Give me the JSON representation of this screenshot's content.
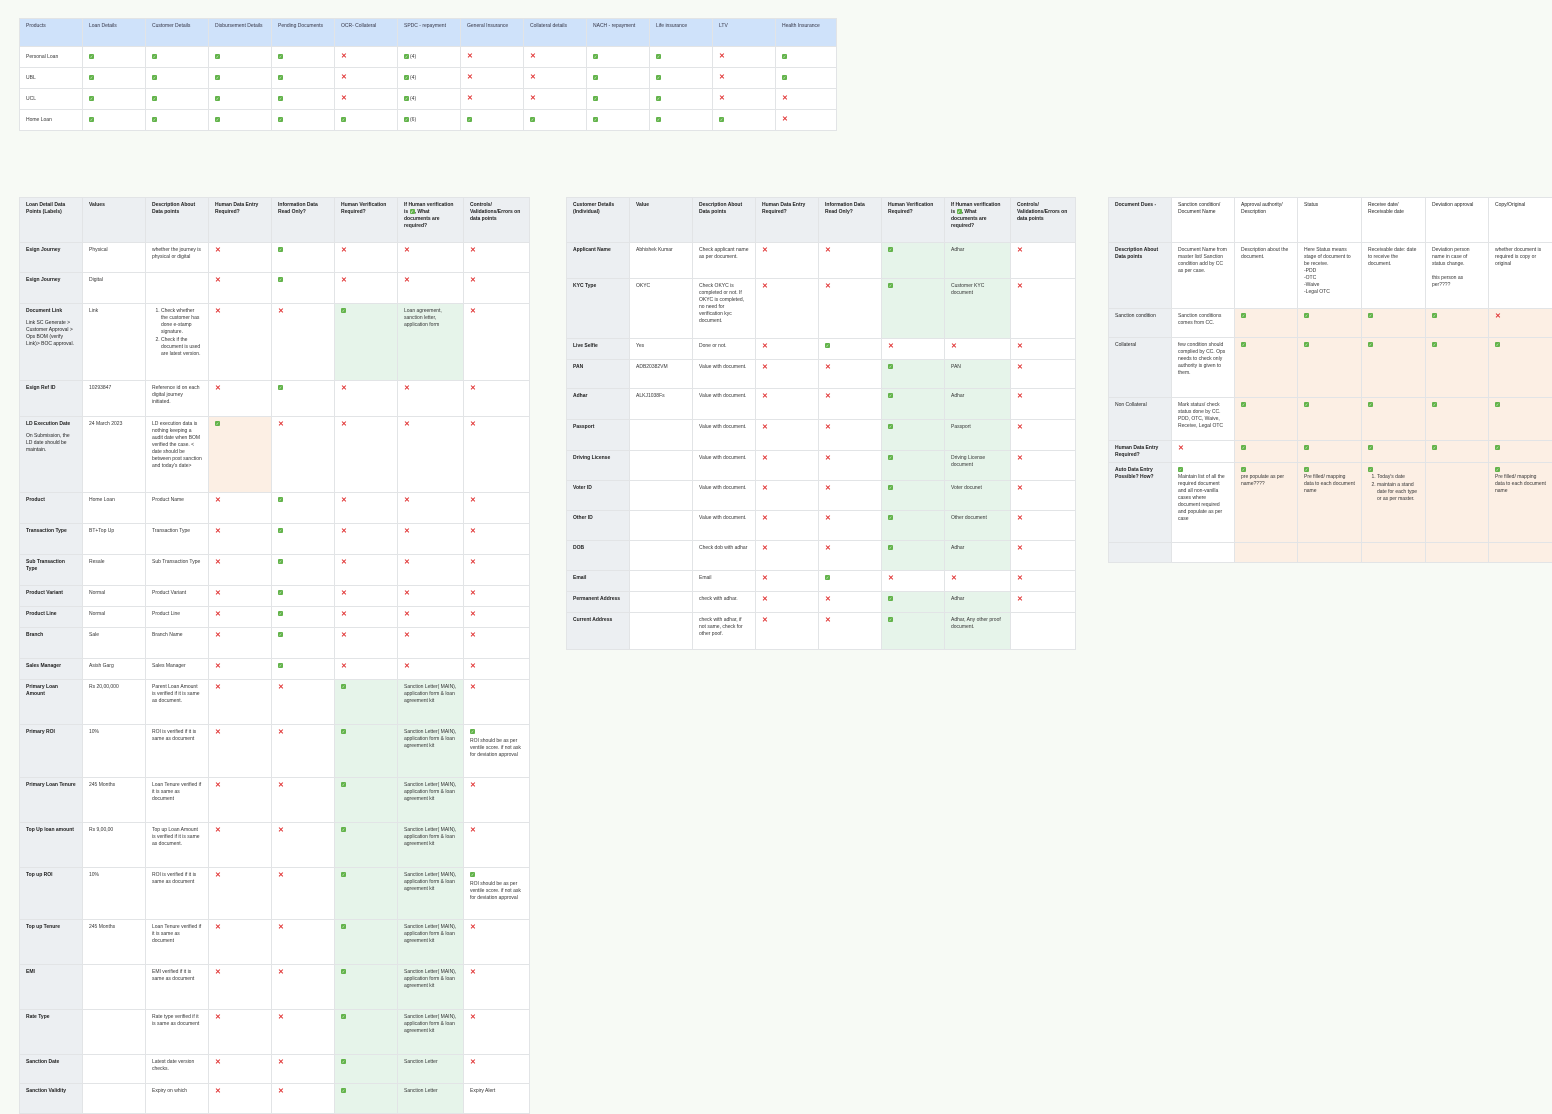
{
  "colors": {
    "header_blue": "#cfe2fa",
    "label_grey": "#eceff2",
    "tick_green": "#62b34a",
    "cross_red": "#e03131",
    "highlight_green": "#e6f4ea",
    "highlight_orange": "#fcefe4"
  },
  "icons": {
    "yes": "check-icon",
    "no": "cross-icon"
  },
  "products_table": {
    "headers": [
      "Products",
      "Loan Details",
      "Customer Details",
      "Disbursement Details",
      "Pending Documents",
      "OCR- Collateral",
      "SPDC - repayment",
      "General Insurance",
      "Collateral details",
      "NACH - repayment",
      "Life insurance",
      "LTV",
      "Health Insurance"
    ],
    "rows": [
      {
        "name": "Personal Loan",
        "cells": [
          "y",
          "y",
          "y",
          "y",
          "n",
          "y",
          "n",
          "n",
          "y",
          "y",
          "n",
          "y"
        ],
        "spdc_count": "(4)"
      },
      {
        "name": "UBL",
        "cells": [
          "y",
          "y",
          "y",
          "y",
          "n",
          "y",
          "n",
          "n",
          "y",
          "y",
          "n",
          "y"
        ],
        "spdc_count": "(4)"
      },
      {
        "name": "UCL",
        "cells": [
          "y",
          "y",
          "y",
          "y",
          "n",
          "y",
          "n",
          "n",
          "y",
          "y",
          "n",
          "n"
        ],
        "spdc_count": "(4)"
      },
      {
        "name": "Home Loan",
        "cells": [
          "y",
          "y",
          "y",
          "y",
          "y",
          "y",
          "y",
          "y",
          "y",
          "y",
          "y",
          "n"
        ],
        "spdc_count": "(6)"
      }
    ]
  },
  "loan_table": {
    "headers": [
      "Loan Detail Data Points (Labels)",
      "Values",
      "Description About Data points",
      "Human Data Entry Required?",
      "Information Data Read Only?",
      "Human Verification Required?",
      "If Human verification is",
      "What documents are required?",
      "Controls/ Validations/Errors on data points"
    ],
    "rows": [
      {
        "label": "Esign Journey",
        "value": "Physical",
        "desc": "whether the journey is physical or digital",
        "marks": [
          "n",
          "y",
          "n",
          "n"
        ],
        "docs": "",
        "ctrl": "n"
      },
      {
        "label": "Esign Journey",
        "value": "Digital",
        "desc": "",
        "marks": [
          "n",
          "y",
          "n",
          "n"
        ],
        "docs": "",
        "ctrl": "n"
      },
      {
        "label": "Document Link",
        "label_note": "Link SC Generate > Customer Approval > Ops BOM (verify Link)> BOC approval.",
        "value": "Link",
        "desc_list": [
          "Check whether the customer has done e-stamp signature.",
          "Check if the document is used are latest version."
        ],
        "marks": [
          "n",
          "n",
          "y",
          ""
        ],
        "docs": "Loan agreement, sanction letter, application form",
        "ctrl": "n"
      },
      {
        "label": "Esign Ref ID",
        "value": "10293847",
        "desc": "Reference id on each digital journey initiated.",
        "marks": [
          "n",
          "y",
          "n",
          "n"
        ],
        "docs": "",
        "ctrl": "n"
      },
      {
        "label": "LD Execution Date",
        "label_note": "On Submission, the LD date should be maintain.",
        "value": "24 March 2023",
        "desc": "LD execution data is nothing keeping a audit date when BOM verified the case. < date should be between post sanction and today's date>",
        "marks": [
          "y",
          "n",
          "n",
          "n"
        ],
        "docs": "",
        "ctrl": "n"
      },
      {
        "label": "Product",
        "value": "Home Loan",
        "desc": "Product Name",
        "marks": [
          "n",
          "y",
          "n",
          "n"
        ],
        "docs": "",
        "ctrl": "n"
      },
      {
        "label": "Transaction Type",
        "value": "BT+Top Up",
        "desc": "Transaction Type",
        "marks": [
          "n",
          "y",
          "n",
          "n"
        ],
        "docs": "",
        "ctrl": "n"
      },
      {
        "label": "Sub Transaction Type",
        "value": "Resale",
        "desc": "Sub Transaction Type",
        "marks": [
          "n",
          "y",
          "n",
          "n"
        ],
        "docs": "",
        "ctrl": "n"
      },
      {
        "label": "Product Variant",
        "value": "Normal",
        "desc": "Product Variant",
        "marks": [
          "n",
          "y",
          "n",
          "n"
        ],
        "docs": "",
        "ctrl": "n"
      },
      {
        "label": "Product Line",
        "value": "Normal",
        "desc": "Product Line",
        "marks": [
          "n",
          "y",
          "n",
          "n"
        ],
        "docs": "",
        "ctrl": "n"
      },
      {
        "label": "Branch",
        "value": "Sale",
        "desc": "Branch Name",
        "marks": [
          "n",
          "y",
          "n",
          "n"
        ],
        "docs": "",
        "ctrl": "n"
      },
      {
        "label": "Sales Manager",
        "value": "Asish Garg",
        "desc": "Sales Manager",
        "marks": [
          "n",
          "y",
          "n",
          "n"
        ],
        "docs": "",
        "ctrl": "n"
      },
      {
        "label": "Primary Loan Amount",
        "value": "Rs 20,00,000",
        "desc": "Parent Loan Amount is verified if it is same as document.",
        "marks": [
          "n",
          "n",
          "y",
          ""
        ],
        "docs": "Sanction Letter( MAIN), application form & loan agreement kit",
        "ctrl": "n"
      },
      {
        "label": "Primary ROI",
        "value": "10%",
        "desc": "ROI is verified if it is same as document",
        "marks": [
          "n",
          "n",
          "y",
          ""
        ],
        "docs": "Sanction Letter( MAIN), application form & loan agreement kit",
        "ctrl": "y",
        "ctrl_note": "ROI should be as per ventile score. if not ask for deviation approval"
      },
      {
        "label": "Primary Loan Tenure",
        "value": "245 Months",
        "desc": "Loan Tenure verified if it is same as document",
        "marks": [
          "n",
          "n",
          "y",
          ""
        ],
        "docs": "Sanction Letter( MAIN), application form & loan agreement kit",
        "ctrl": "n"
      },
      {
        "label": "Top Up loan amount",
        "value": "Rs 9,00,00",
        "desc": "Top up Loan Amount is verified if it is same as document.",
        "marks": [
          "n",
          "n",
          "y",
          ""
        ],
        "docs": "Sanction Letter( MAIN), application form & loan agreement kit",
        "ctrl": "n"
      },
      {
        "label": "Top up ROI",
        "value": "10%",
        "desc": "ROI is verified if it is same as document",
        "marks": [
          "n",
          "n",
          "y",
          ""
        ],
        "docs": "Sanction Letter( MAIN), application form & loan agreement kit",
        "ctrl": "y",
        "ctrl_note": "ROI should be as per ventile score. if not ask for deviation approval"
      },
      {
        "label": "Top up Tenure",
        "value": "245 Months",
        "desc": "Loan Tenure verified if it is same as document",
        "marks": [
          "n",
          "n",
          "y",
          ""
        ],
        "docs": "Sanction Letter( MAIN), application form & loan agreement kit",
        "ctrl": "n"
      },
      {
        "label": "EMI",
        "value": "",
        "desc": "EMI verified if it is same as document",
        "marks": [
          "n",
          "n",
          "y",
          ""
        ],
        "docs": "Sanction Letter( MAIN), application form & loan agreement kit",
        "ctrl": "n"
      },
      {
        "label": "Rate Type",
        "value": "",
        "desc": "Rate type verified if it is same as document",
        "marks": [
          "n",
          "n",
          "y",
          ""
        ],
        "docs": "Sanction Letter( MAIN), application form & loan agreement kit",
        "ctrl": "n"
      },
      {
        "label": "Sanction Date",
        "value": "",
        "desc": "Latest date version checks.",
        "marks": [
          "n",
          "n",
          "y",
          ""
        ],
        "docs": "Sanction Letter",
        "ctrl": "n"
      },
      {
        "label": "Sanction Validity",
        "value": "",
        "desc": "Expiry on which",
        "marks": [
          "n",
          "n",
          "y",
          ""
        ],
        "docs": "Sanction Letter",
        "ctrl": "",
        "ctrl_note": "Expiry Alert"
      }
    ]
  },
  "customer_table": {
    "headers": [
      "Customer Details (Individual)",
      "Value",
      "Description About Data points",
      "Human Data Entry Required?",
      "Information Data Read Only?",
      "Human Verification Required?",
      "If Human verification is",
      "What documents are required?",
      "Controls/ Validations/Errors on data points"
    ],
    "rows": [
      {
        "label": "Applicant Name",
        "value": "Abhishek Kumar",
        "desc": "Check applicant name as per document.",
        "marks": [
          "n",
          "n",
          "y",
          ""
        ],
        "docs": "Adhar",
        "ctrl": "n"
      },
      {
        "label": "KYC Type",
        "value": "OKYC",
        "desc": "Check OKYC is completed or not. If OKYC is completed, no need for verification kyc document.",
        "marks": [
          "n",
          "n",
          "y",
          ""
        ],
        "docs": "Customer KYC document",
        "ctrl": "n"
      },
      {
        "label": "Live Selfie",
        "value": "Yes",
        "desc": "Done or not.",
        "marks": [
          "n",
          "y",
          "n",
          "n"
        ],
        "docs": "",
        "ctrl": "n"
      },
      {
        "label": "PAN",
        "value": "ADB20382VM",
        "desc": "Value with document.",
        "marks": [
          "n",
          "n",
          "y",
          ""
        ],
        "docs": "PAN",
        "ctrl": "n"
      },
      {
        "label": "Adhar",
        "value": "ALKJ1038Fs",
        "desc": "Value with document.",
        "marks": [
          "n",
          "n",
          "y",
          ""
        ],
        "docs": "Adhar",
        "ctrl": "n"
      },
      {
        "label": "Passport",
        "value": "",
        "desc": "Value with document.",
        "marks": [
          "n",
          "n",
          "y",
          ""
        ],
        "docs": "Passport",
        "ctrl": "n"
      },
      {
        "label": "Driving License",
        "value": "",
        "desc": "Value with document.",
        "marks": [
          "n",
          "n",
          "y",
          ""
        ],
        "docs": "Driving License document",
        "ctrl": "n"
      },
      {
        "label": "Voter ID",
        "value": "",
        "desc": "Value with document.",
        "marks": [
          "n",
          "n",
          "y",
          ""
        ],
        "docs": "Voter docunet",
        "ctrl": "n"
      },
      {
        "label": "Other ID",
        "value": "",
        "desc": "Value with document.",
        "marks": [
          "n",
          "n",
          "y",
          ""
        ],
        "docs": "Other document",
        "ctrl": "n"
      },
      {
        "label": "DOB",
        "value": "",
        "desc": "Check dob with adhar",
        "marks": [
          "n",
          "n",
          "y",
          ""
        ],
        "docs": "Adhar",
        "ctrl": "n"
      },
      {
        "label": "Email",
        "value": "",
        "desc": "Email",
        "marks": [
          "n",
          "y",
          "n",
          "n"
        ],
        "docs": "",
        "ctrl": "n"
      },
      {
        "label": "Permanent Address",
        "value": "",
        "desc": "check with adhar.",
        "marks": [
          "n",
          "n",
          "y",
          ""
        ],
        "docs": "Adhar",
        "ctrl": "n"
      },
      {
        "label": "Current Address",
        "value": "",
        "desc": "check with adhar, if not same, check for other poof.",
        "marks": [
          "n",
          "n",
          "y",
          ""
        ],
        "docs": "Adhar, Any other proof document.",
        "ctrl": ""
      }
    ]
  },
  "dues_table": {
    "headers": [
      "Document Dues -",
      "Sanction condition/ Document Name",
      "Approval authority/ Description",
      "Status",
      "Receive date/ Receivable date",
      "Deviation approval",
      "Copy/Original"
    ],
    "desc_row": {
      "label": "Description About Data points",
      "cells": [
        "Document Name from master list/ Sanction condition add by CC as per case.",
        "Description about the document.",
        "Here Status means stage of document to be receive.\n-PDD\n-OTC\n-Waive\n-Legal OTC",
        "Receivable date: date to receive the document.",
        "Deviation person name in case of status change.\n\nthis person as per????",
        "whether document is required is copy or original"
      ]
    },
    "rows": [
      {
        "label": "Sanction condition",
        "text": "Sanction conditions comes from CC.",
        "marks": [
          "y",
          "y",
          "y",
          "y",
          "n"
        ]
      },
      {
        "label": "Collateral",
        "text": "few condition should complied by CC. Ops needs to check only authority is given to them.",
        "marks": [
          "y",
          "y",
          "y",
          "y",
          "y"
        ]
      },
      {
        "label": "Non Collateral",
        "text": "Mark status/ check status done by CC. PDD, OTC, Waive, Receive, Legal OTC",
        "marks": [
          "y",
          "y",
          "y",
          "y",
          "y"
        ]
      }
    ],
    "entry_row": {
      "label": "Human Data Entry Required?",
      "marks": [
        "n",
        "y",
        "y",
        "y",
        "y",
        "y"
      ]
    },
    "auto_row": {
      "label": "Auto Data Entry Possible? How?",
      "c1": "Maintain list of all the required document and all non-vanilla cases where document required and populate as per case",
      "c2": "pre populate as per name????",
      "c3": "Pre filled/ mapping data to each document name",
      "c4_list": [
        "Today's date",
        "maintain a stand date for each type or as per master."
      ],
      "c6": "Pre filled/ mapping data to each document name"
    }
  }
}
